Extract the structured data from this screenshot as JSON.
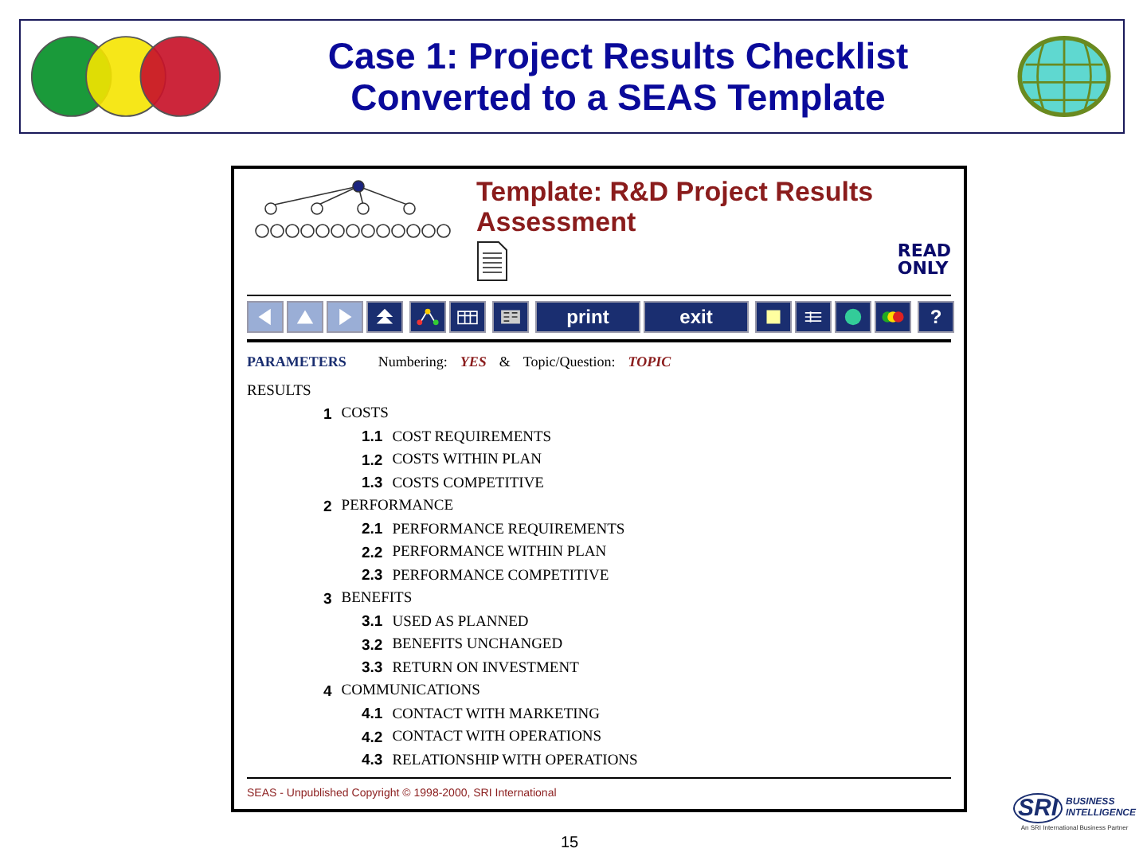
{
  "slide": {
    "title_lines": [
      "Case 1: Project Results Checklist",
      "Converted to a SEAS Template"
    ],
    "page_number": "15"
  },
  "template": {
    "title_lines": [
      "Template: R&D Project Results",
      "Assessment"
    ],
    "badge_lines": [
      "READ",
      "ONLY"
    ]
  },
  "toolbar": [
    {
      "kind": "icon",
      "disabled": true
    },
    {
      "kind": "icon",
      "disabled": true
    },
    {
      "kind": "icon",
      "disabled": true
    },
    {
      "kind": "icon",
      "disabled": false
    },
    {
      "kind": "gap"
    },
    {
      "kind": "icon",
      "disabled": false
    },
    {
      "kind": "icon",
      "disabled": false
    },
    {
      "kind": "gap"
    },
    {
      "kind": "icon",
      "disabled": false
    },
    {
      "kind": "gap"
    },
    {
      "kind": "text",
      "label": "print",
      "disabled": false
    },
    {
      "kind": "text",
      "label": "exit",
      "disabled": false
    },
    {
      "kind": "gap"
    },
    {
      "kind": "icon",
      "disabled": false
    },
    {
      "kind": "icon",
      "disabled": false
    },
    {
      "kind": "icon",
      "disabled": false
    },
    {
      "kind": "icon",
      "disabled": false
    },
    {
      "kind": "gap"
    },
    {
      "kind": "text",
      "label": "?",
      "disabled": false
    }
  ],
  "parameters": {
    "label": "PARAMETERS",
    "numbering_label": "Numbering:",
    "numbering_value": "YES",
    "joiner": "&",
    "topic_label": "Topic/Question:",
    "topic_value": "TOPIC"
  },
  "outline": [
    {
      "label": "RESULTS",
      "children": [
        {
          "number": "1",
          "label": "COSTS",
          "children": [
            {
              "number": "1.1",
              "label": "COST REQUIREMENTS"
            },
            {
              "number": "1.2",
              "label": "COSTS WITHIN PLAN"
            },
            {
              "number": "1.3",
              "label": "COSTS COMPETITIVE"
            }
          ]
        },
        {
          "number": "2",
          "label": "PERFORMANCE",
          "children": [
            {
              "number": "2.1",
              "label": "PERFORMANCE REQUIREMENTS"
            },
            {
              "number": "2.2",
              "label": "PERFORMANCE WITHIN PLAN"
            },
            {
              "number": "2.3",
              "label": "PERFORMANCE COMPETITIVE"
            }
          ]
        },
        {
          "number": "3",
          "label": "BENEFITS",
          "children": [
            {
              "number": "3.1",
              "label": "USED AS PLANNED"
            },
            {
              "number": "3.2",
              "label": "BENEFITS UNCHANGED"
            },
            {
              "number": "3.3",
              "label": "RETURN ON INVESTMENT"
            }
          ]
        },
        {
          "number": "4",
          "label": "COMMUNICATIONS",
          "children": [
            {
              "number": "4.1",
              "label": "CONTACT WITH MARKETING"
            },
            {
              "number": "4.2",
              "label": "CONTACT WITH OPERATIONS"
            },
            {
              "number": "4.3",
              "label": "RELATIONSHIP WITH OPERATIONS"
            }
          ]
        }
      ]
    }
  ],
  "footer": "SEAS - Unpublished Copyright © 1998-2000, SRI International",
  "logo": {
    "mark": "SRI",
    "lines": [
      "BUSINESS",
      "INTELLIGENCE"
    ],
    "tagline": "An SRI International Business Partner"
  }
}
